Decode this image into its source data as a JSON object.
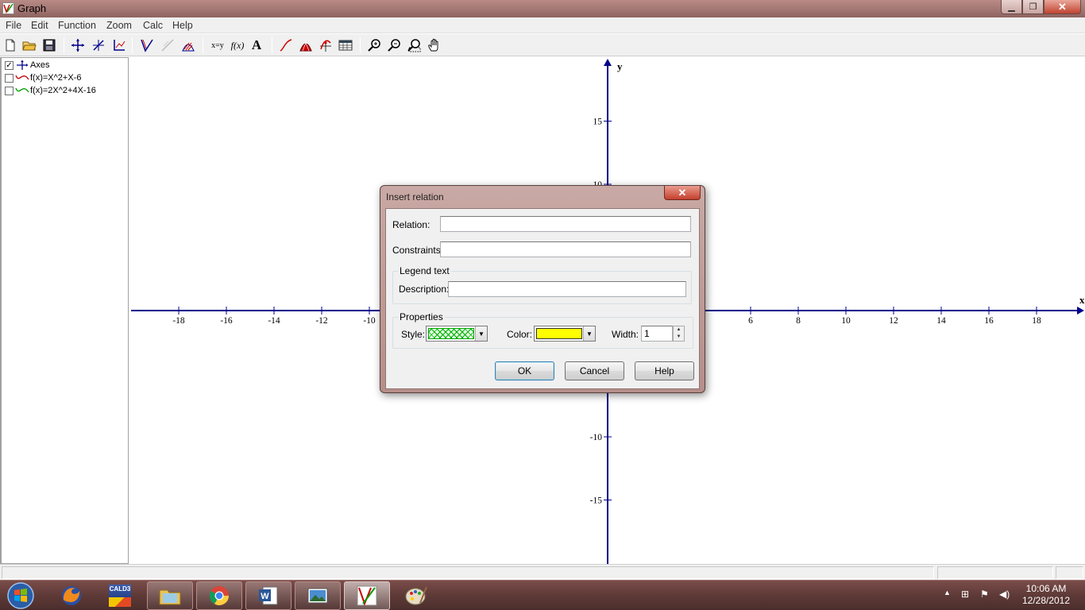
{
  "window": {
    "title": "Graph"
  },
  "menu": [
    "File",
    "Edit",
    "Function",
    "Zoom",
    "Calc",
    "Help"
  ],
  "toolbar": {
    "icons": [
      "new-file-icon",
      "open-folder-icon",
      "save-icon",
      "move-axes-icon",
      "insert-tangent-icon",
      "coordinate-system-icon",
      "insert-function-icon",
      "insert-tangent-icon-2",
      "insert-shading-icon",
      "insert-point-series-icon",
      "insert-xy-relation-icon",
      "insert-fx-icon",
      "insert-label-icon",
      "insert-trendline-icon",
      "evaluate-icon",
      "table-icon",
      "zoom-in-icon",
      "zoom-out-icon",
      "zoom-window-icon",
      "pan-hand-icon"
    ],
    "xy_label": "x=y",
    "fx_label": "f(x)",
    "text_label": "A"
  },
  "functions": [
    {
      "label": "Axes",
      "checked": true,
      "color": "#00008b"
    },
    {
      "label": "f(x)=X^2+X-6",
      "checked": false,
      "color": "#c00000"
    },
    {
      "label": "f(x)=2X^2+4X-16",
      "checked": false,
      "color": "#00a000"
    }
  ],
  "graph": {
    "x_axis_label": "x",
    "y_axis_label": "y",
    "x_ticks": [
      "-18",
      "-16",
      "-14",
      "-12",
      "-10",
      "6",
      "8",
      "10",
      "12",
      "14",
      "16",
      "18"
    ],
    "y_ticks": [
      "15",
      "10",
      "-10",
      "-15"
    ],
    "axis_color": "#00008b"
  },
  "dialog": {
    "title": "Insert relation",
    "relation_label": "Relation:",
    "relation_value": "",
    "constraints_label": "Constraints:",
    "constraints_value": "",
    "legend_group": "Legend text",
    "description_label": "Description:",
    "description_value": "",
    "properties_group": "Properties",
    "style_label": "Style:",
    "color_label": "Color:",
    "color_value": "#ffff00",
    "width_label": "Width:",
    "width_value": "1",
    "ok": "OK",
    "cancel": "Cancel",
    "help": "Help"
  },
  "taskbar": {
    "apps": [
      "firefox-icon",
      "cald3-app-icon",
      "file-explorer-icon",
      "chrome-icon",
      "word-icon",
      "image-viewer-icon",
      "graph-app-icon",
      "paint-icon"
    ],
    "cald3_label": "CALD3",
    "time": "10:06 AM",
    "date": "12/28/2012"
  }
}
